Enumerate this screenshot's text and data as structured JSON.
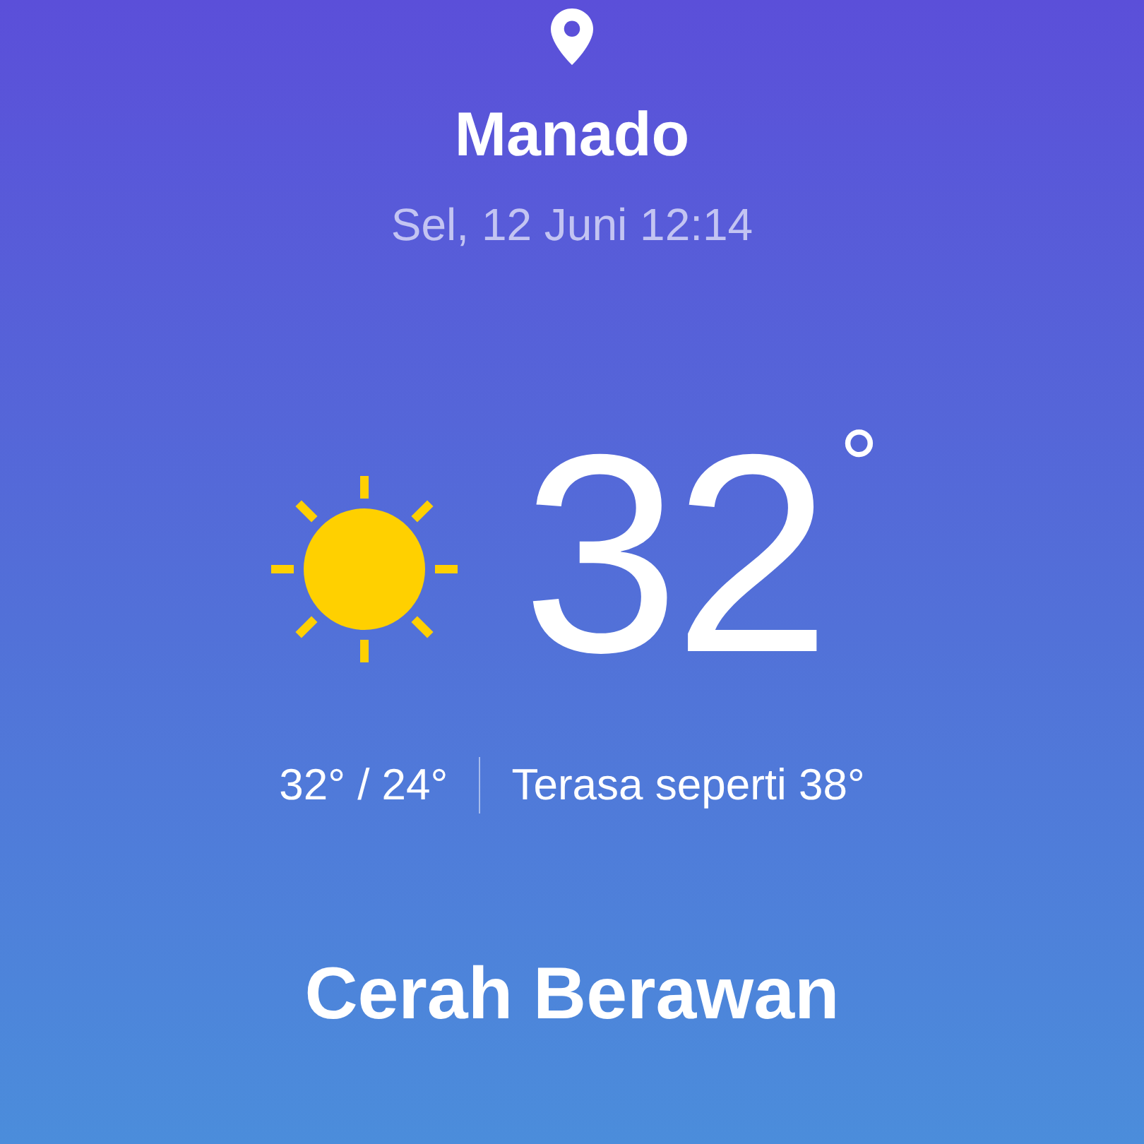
{
  "location": {
    "city": "Manado",
    "datetime": "Sel, 12 Juni 12:14"
  },
  "current": {
    "temperature": "32",
    "degree_symbol": "°",
    "high_low": "32° / 24°",
    "feels_like": "Terasa seperti 38°",
    "condition": "Cerah Berawan"
  }
}
